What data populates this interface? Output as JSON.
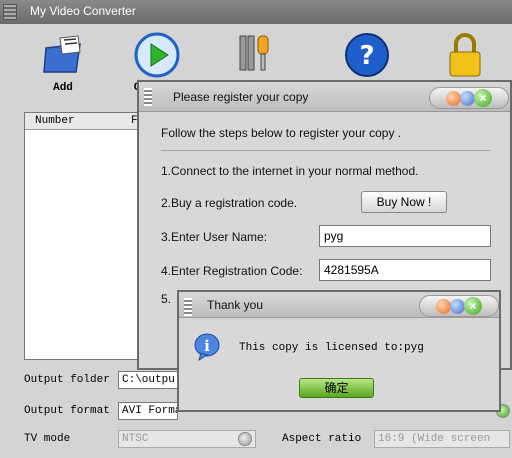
{
  "main": {
    "title": "My Video Converter",
    "toolbar": [
      {
        "label": "Add",
        "icon": "add-folder-icon"
      },
      {
        "label": "C",
        "icon": "convert-play-icon"
      },
      {
        "label": "",
        "icon": "tools-icon"
      },
      {
        "label": "",
        "icon": "help-icon"
      },
      {
        "label": "",
        "icon": "lock-icon"
      }
    ],
    "file_list": {
      "columns": [
        "Number",
        "F"
      ]
    },
    "output_folder_label": "Output folder",
    "output_folder_value": "C:\\outpu",
    "output_format_label": "Output format",
    "output_format_value": "AVI Forma",
    "tv_mode_label": "TV mode",
    "tv_mode_value": "NTSC",
    "aspect_ratio_label": "Aspect ratio",
    "aspect_ratio_value": "16:9  (Wide screen"
  },
  "register_dialog": {
    "title": "Please register your copy",
    "intro": "Follow the steps below to register your copy .",
    "step1": "1.Connect to the internet in your normal method.",
    "step2": "2.Buy a registration code.",
    "buy_label": "Buy Now !",
    "step3": "3.Enter User Name:",
    "user_name": "pyg",
    "step4": "4.Enter Registration Code:",
    "reg_code": "4281595A",
    "step5": "5."
  },
  "thankyou_dialog": {
    "title": "Thank you",
    "message": "This copy is licensed to:pyg",
    "ok_label": "确定"
  },
  "colors": {
    "accent_green": "#5aa61e",
    "titlebar": "#6a6a6a"
  }
}
